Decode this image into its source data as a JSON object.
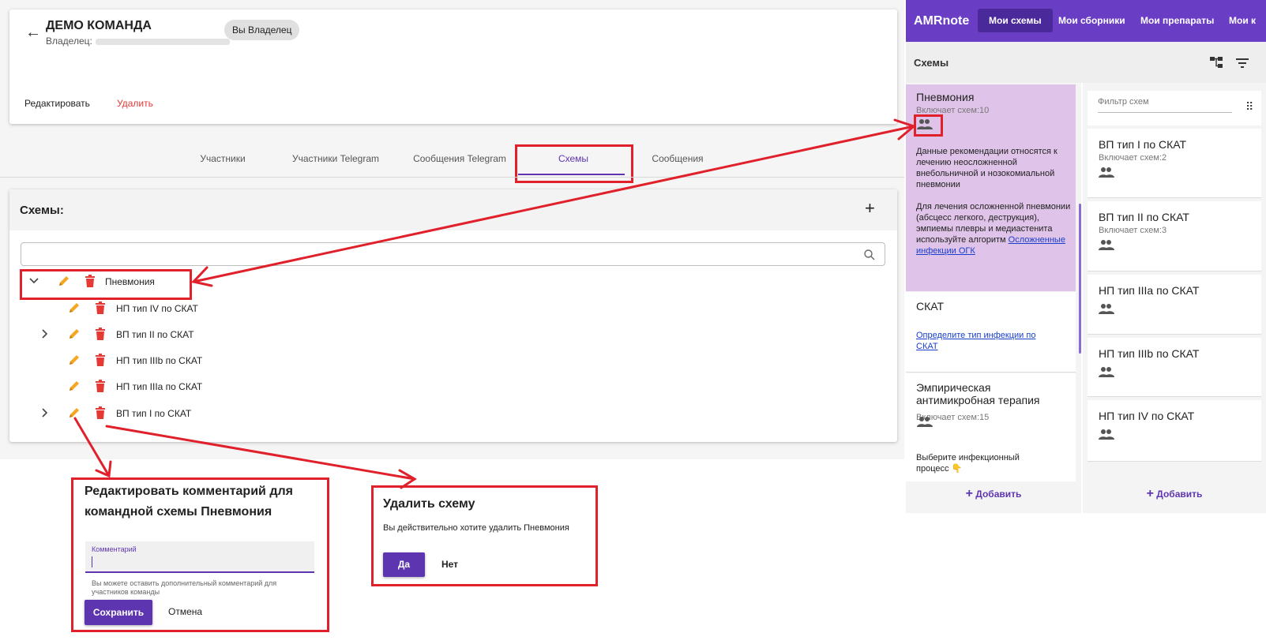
{
  "team": {
    "title": "ДЕМО КОМАНДА",
    "owner_label": "Владелец:",
    "owner_chip": "Вы Владелец",
    "edit_label": "Редактировать",
    "delete_label": "Удалить"
  },
  "tabs": [
    "Участники",
    "Участники Telegram",
    "Сообщения Telegram",
    "Схемы",
    "Сообщения"
  ],
  "schemes_panel": {
    "title": "Схемы:",
    "add_icon": "plus-icon",
    "search_icon": "search-icon",
    "tree": [
      {
        "label": "Пневмония",
        "expanded": true
      },
      {
        "label": "НП тип IV по СКАТ"
      },
      {
        "label": "ВП тип II по СКАТ",
        "expandable": true
      },
      {
        "label": "НП тип IIIb по СКАТ"
      },
      {
        "label": "НП тип IIIa по СКАТ"
      },
      {
        "label": "ВП тип I по СКАТ",
        "expandable": true
      }
    ]
  },
  "edit_dialog": {
    "title": "Редактировать комментарий для командной схемы Пневмония",
    "field_label": "Комментарий",
    "field_value": "",
    "hint": "Вы можете оставить дополнительный комментарий для участников команды",
    "save": "Сохранить",
    "cancel": "Отмена"
  },
  "delete_dialog": {
    "title": "Удалить схему",
    "body": "Вы действительно хотите удалить Пневмония",
    "yes": "Да",
    "no": "Нет"
  },
  "app": {
    "brand": "AMRnote",
    "nav": [
      "Мои схемы",
      "Мои сборники",
      "Мои препараты",
      "Мои к"
    ],
    "subheader": "Схемы",
    "filter_placeholder": "Фильтр схем",
    "add_label": "Добавить",
    "left_list": [
      {
        "title": "Пневмония",
        "subtitle": "Включает схем:10",
        "desc1": "Данные рекомендации относятся к лечению неосложненной внебольничной и нозокомиальной пневмонии",
        "desc2": "Для лечения осложненной пневмонии (абсцесс легкого, деструкция), эмпиемы плевры и медиастенита используйте алгоритм",
        "link": "Осложненные инфекции ОГК"
      },
      {
        "title": "СКАТ",
        "link": "Определите тип инфекции по СКАТ"
      },
      {
        "title": "Эмпирическая антимикробная терапия",
        "subtitle": "Включает схем:15",
        "desc1": "Выберите инфекционный процесс 👇"
      }
    ],
    "right_list": [
      {
        "title": "ВП тип I по СКАТ",
        "subtitle": "Включает схем:2"
      },
      {
        "title": "ВП тип II по СКАТ",
        "subtitle": "Включает схем:3"
      },
      {
        "title": "НП тип IIIa по СКАТ"
      },
      {
        "title": "НП тип IIIb по СКАТ"
      },
      {
        "title": "НП тип IV по СКАТ"
      }
    ]
  },
  "colors": {
    "accent": "#6a3ec4",
    "highlight": "#e0202a",
    "selected_item": "#dfc3e8",
    "pencil": "#f5a623",
    "trash": "#e53935"
  }
}
